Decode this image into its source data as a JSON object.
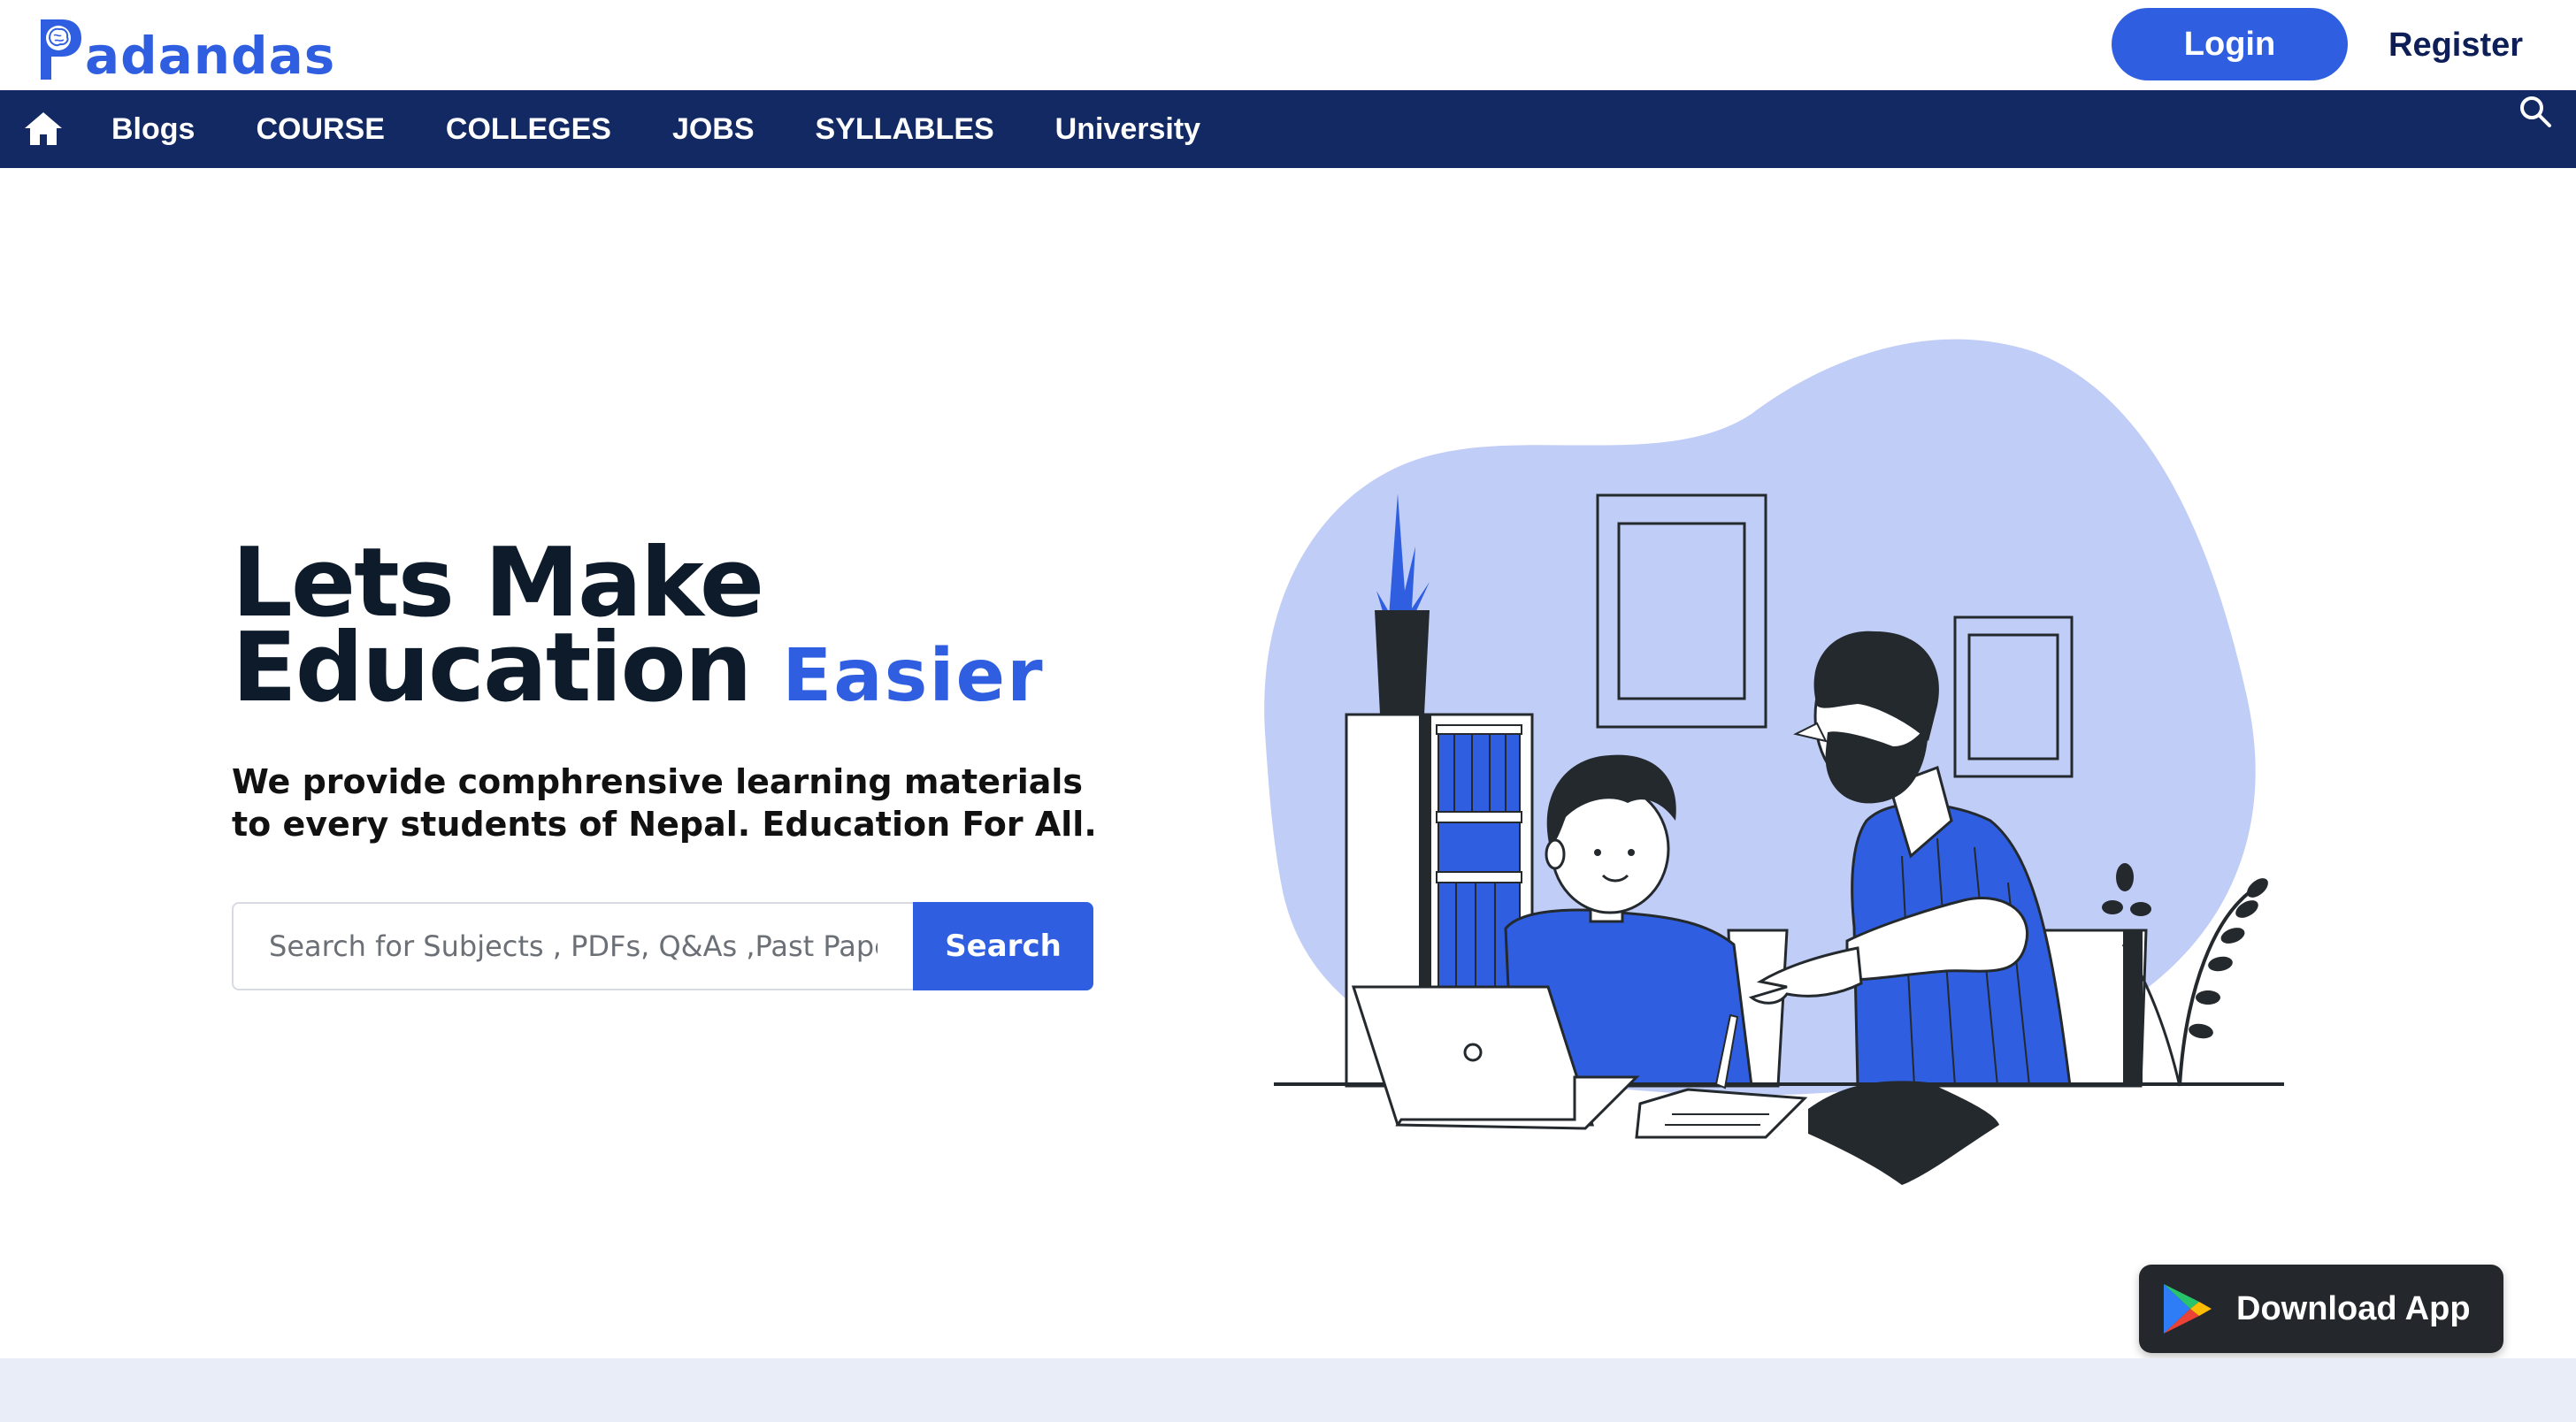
{
  "brand": {
    "name": "adandas",
    "accent_color": "#2f5fe0",
    "nav_color": "#132964"
  },
  "header": {
    "login_label": "Login",
    "register_label": "Register"
  },
  "nav": {
    "home_icon": "home-icon",
    "items": [
      {
        "label": "Blogs"
      },
      {
        "label": "COURSE"
      },
      {
        "label": "COLLEGES"
      },
      {
        "label": "JOBS"
      },
      {
        "label": "SYLLABLES"
      },
      {
        "label": "University"
      }
    ],
    "search_icon": "search-icon"
  },
  "hero": {
    "title_line1": "Lets Make",
    "title_line2": "Education",
    "title_accent": "Easier",
    "subtitle": "We provide comphrensive learning materials to every students of Nepal. Education For All.",
    "search_placeholder": "Search for Subjects , PDFs, Q&As ,Past Papers",
    "search_button": "Search"
  },
  "download": {
    "label": "Download App",
    "icon": "google-play-icon"
  }
}
